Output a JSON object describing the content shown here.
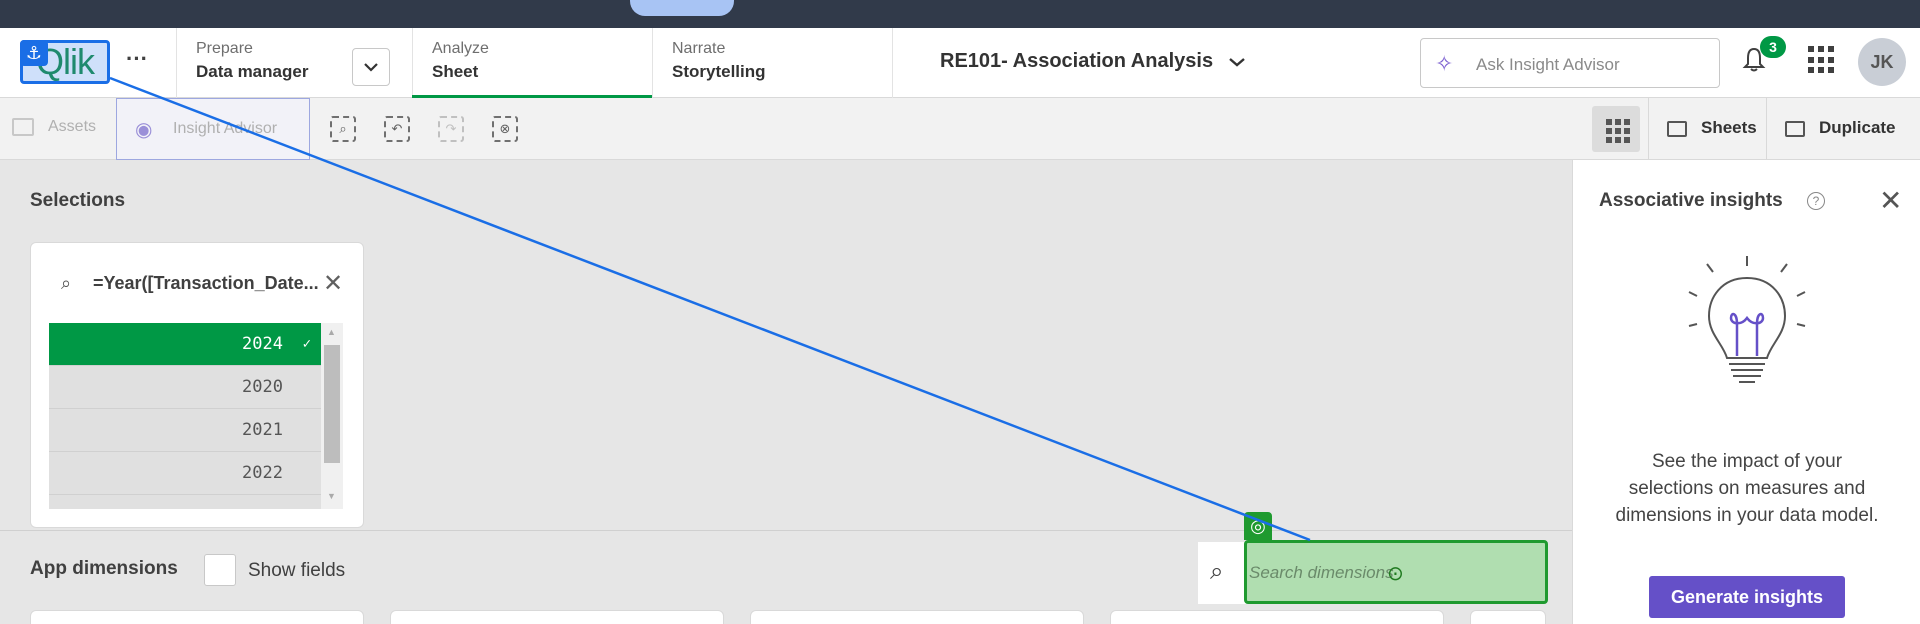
{
  "navbar": {
    "logo_text": "Qlik",
    "sections": [
      {
        "small": "Prepare",
        "big": "Data manager"
      },
      {
        "small": "Analyze",
        "big": "Sheet"
      },
      {
        "small": "Narrate",
        "big": "Storytelling"
      }
    ],
    "app_title": "RE101- Association Analysis",
    "ask_placeholder": "Ask Insight Advisor",
    "notification_count": "3",
    "avatar_initials": "JK"
  },
  "toolbar": {
    "assets_label": "Assets",
    "insight_label": "Insight Advisor",
    "sheets_label": "Sheets",
    "duplicate_label": "Duplicate"
  },
  "selections": {
    "title": "Selections",
    "listbox": {
      "field": "=Year([Transaction_Date...",
      "values": [
        {
          "label": "2024",
          "selected": true
        },
        {
          "label": "2020",
          "selected": false
        },
        {
          "label": "2021",
          "selected": false
        },
        {
          "label": "2022",
          "selected": false
        },
        {
          "label": "",
          "selected": false
        }
      ]
    }
  },
  "app_dimensions": {
    "title": "App dimensions",
    "show_fields_label": "Show fields",
    "search_placeholder": "Search dimensions"
  },
  "insights_panel": {
    "title": "Associative insights",
    "description": "See the impact of your selections on measures and dimensions in your data model.",
    "generate_label": "Generate insights"
  },
  "colors": {
    "accent_green": "#009845",
    "brand_purple": "#6550c8",
    "overlay_blue": "#1a6ee6"
  }
}
